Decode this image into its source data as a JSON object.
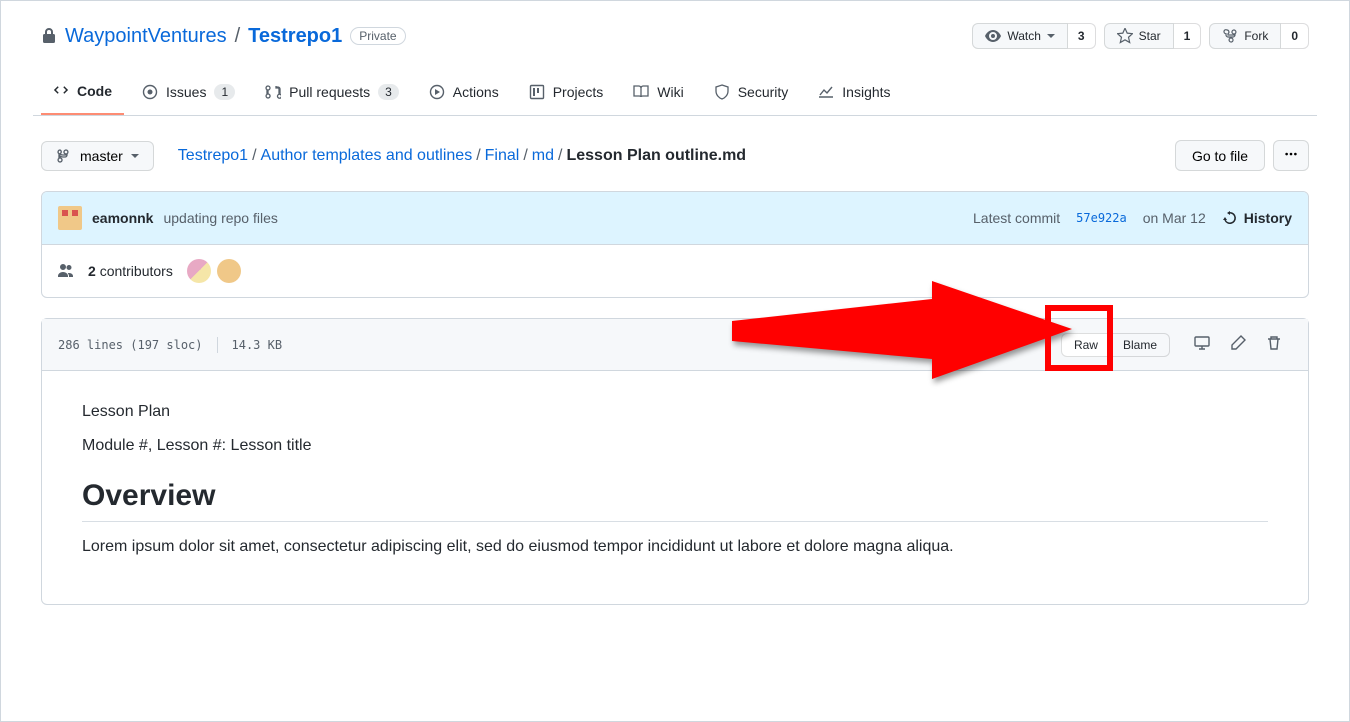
{
  "repo": {
    "owner": "WaypointVentures",
    "name": "Testrepo1",
    "visibility": "Private"
  },
  "actions": {
    "watch": {
      "label": "Watch",
      "count": "3"
    },
    "star": {
      "label": "Star",
      "count": "1"
    },
    "fork": {
      "label": "Fork",
      "count": "0"
    }
  },
  "tabs": {
    "code": "Code",
    "issues": {
      "label": "Issues",
      "count": "1"
    },
    "pulls": {
      "label": "Pull requests",
      "count": "3"
    },
    "actions": "Actions",
    "projects": "Projects",
    "wiki": "Wiki",
    "security": "Security",
    "insights": "Insights"
  },
  "branch": "master",
  "breadcrumb": {
    "root": "Testrepo1",
    "p1": "Author templates and outlines",
    "p2": "Final",
    "p3": "md",
    "file": "Lesson Plan outline.md"
  },
  "go_to_file": "Go to file",
  "commit": {
    "author": "eamonnk",
    "message": "updating repo files",
    "latest_label": "Latest commit",
    "sha": "57e922a",
    "date": "on Mar 12",
    "history": "History"
  },
  "contributors": {
    "count": "2",
    "label": "contributors"
  },
  "file_meta": {
    "lines": "286 lines (197 sloc)",
    "size": "14.3 KB"
  },
  "file_buttons": {
    "raw": "Raw",
    "blame": "Blame"
  },
  "content": {
    "line1": "Lesson Plan",
    "line2": "Module #, Lesson #: Lesson title",
    "heading": "Overview",
    "body": "Lorem ipsum dolor sit amet, consectetur adipiscing elit, sed do eiusmod tempor incididunt ut labore et dolore magna aliqua."
  }
}
